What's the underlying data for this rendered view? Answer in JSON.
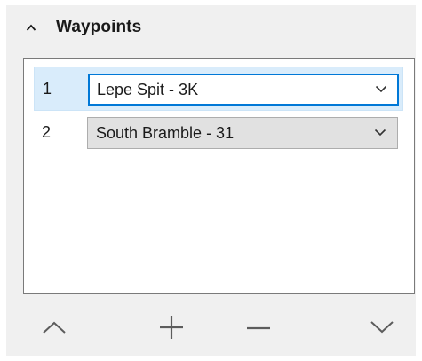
{
  "panel": {
    "title": "Waypoints",
    "collapse_icon": "chevron-up-icon"
  },
  "waypoints": [
    {
      "index": "1",
      "value": "Lepe Spit - 3K",
      "selected": true
    },
    {
      "index": "2",
      "value": "South Bramble - 31",
      "selected": false
    }
  ],
  "toolbar": {
    "move_up_icon": "chevron-up-icon",
    "add_icon": "plus-icon",
    "remove_icon": "minus-icon",
    "move_down_icon": "chevron-down-icon"
  },
  "colors": {
    "panel_bg": "#f0f0f0",
    "selection_bg": "#d9ecfb",
    "focus_border": "#0078d7",
    "combo_bg": "#e1e1e1",
    "icon_color": "#5c5c5c"
  }
}
